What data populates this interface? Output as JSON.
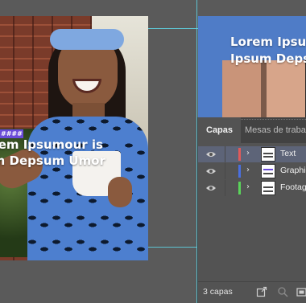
{
  "artboard_left": {
    "badge_text": "####",
    "headline_line1": "orem Ipsumour is",
    "headline_line2": "um Depsum Umor"
  },
  "artboard_right": {
    "headline_line1": "Lorem Ipsu",
    "headline_line2": "Ipsum Deps"
  },
  "layers_panel": {
    "tabs": [
      {
        "label": "Capas",
        "active": true
      },
      {
        "label": "Mesas de traba",
        "active": false
      }
    ],
    "layers": [
      {
        "name": "Text",
        "color": "#e05a5a",
        "visible": true,
        "selected": true
      },
      {
        "name": "Graphic",
        "color": "#4a6fe0",
        "visible": true,
        "selected": false
      },
      {
        "name": "Footag",
        "color": "#5ad45a",
        "visible": true,
        "selected": false
      }
    ],
    "footer_count": "3 capas",
    "footer_icons": [
      "export-icon",
      "search-icon",
      "new-layer-icon"
    ]
  },
  "colors": {
    "guide": "#5fd7e8",
    "canvas_bg": "#5a5a5a",
    "panel_bg": "#535353",
    "selected_row": "#5d6478"
  }
}
